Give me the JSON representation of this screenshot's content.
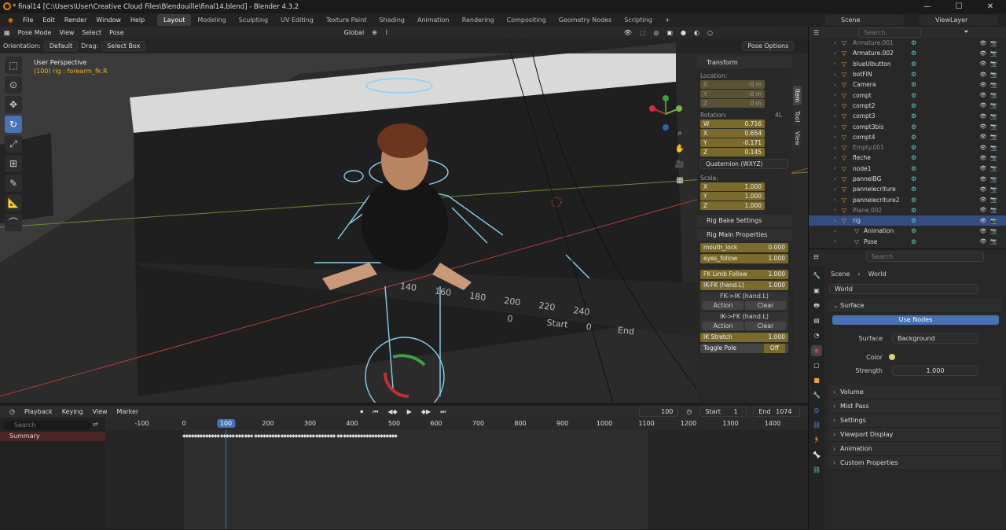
{
  "window": {
    "title": "* final14 [C:\\Users\\User\\Creative Cloud Files\\Blendouille\\final14.blend] - Blender 4.3.2"
  },
  "menu": {
    "items": [
      "File",
      "Edit",
      "Render",
      "Window",
      "Help"
    ],
    "workspaces": [
      "Layout",
      "Modeling",
      "Sculpting",
      "UV Editing",
      "Texture Paint",
      "Shading",
      "Animation",
      "Rendering",
      "Compositing",
      "Geometry Nodes",
      "Scripting"
    ],
    "add": "+",
    "scene": "Scene",
    "view_layer": "ViewLayer"
  },
  "viewport": {
    "mode": "Pose Mode",
    "menus": [
      "View",
      "Select",
      "Pose"
    ],
    "transform_orientation": "Global",
    "orientation_label": "Orientation:",
    "orientation_value": "Default",
    "drag_label": "Drag:",
    "drag_value": "Select Box",
    "pose_options": "Pose Options",
    "perspective": "User Perspective",
    "object_info": "(100) rig : forearm_fk.R",
    "bg_timeline": {
      "frames": [
        "0",
        "Start",
        "0",
        "End"
      ],
      "ticks": [
        "140",
        "160",
        "180",
        "200",
        "220",
        "240"
      ]
    }
  },
  "npanel": {
    "tabs": [
      "Item",
      "Tool",
      "View"
    ],
    "transform": {
      "title": "Transform",
      "location_label": "Location:",
      "location": [
        {
          "axis": "X",
          "value": "-0 m"
        },
        {
          "axis": "Y",
          "value": "-0 m"
        },
        {
          "axis": "Z",
          "value": "0 m"
        }
      ],
      "rotation_label": "Rotation:",
      "rotation_mode_short": "4L",
      "rotation": [
        {
          "axis": "W",
          "value": "0.716"
        },
        {
          "axis": "X",
          "value": "0.654"
        },
        {
          "axis": "Y",
          "value": "-0.171"
        },
        {
          "axis": "Z",
          "value": "0.145"
        }
      ],
      "rotation_mode": "Quaternion (WXYZ)",
      "scale_label": "Scale:",
      "scale": [
        {
          "axis": "X",
          "value": "1.000"
        },
        {
          "axis": "Y",
          "value": "1.000"
        },
        {
          "axis": "Z",
          "value": "1.000"
        }
      ]
    },
    "rig_bake": "Rig Bake Settings",
    "rig_main": "Rig Main Properties",
    "props": [
      {
        "name": "mouth_lock",
        "value": "0.000"
      },
      {
        "name": "eyes_follow",
        "value": "1.000"
      }
    ],
    "limb": [
      {
        "name": "FK Limb Follow",
        "value": "1.000"
      },
      {
        "name": "IK-FK (hand.L)",
        "value": "1.000"
      }
    ],
    "fk_ik": {
      "label": "FK->IK (hand.L)",
      "action": "Action",
      "clear": "Clear"
    },
    "ik_fk": {
      "label": "IK->FK (hand.L)",
      "action": "Action",
      "clear": "Clear"
    },
    "ik_stretch": {
      "name": "IK Stretch",
      "value": "1.000"
    },
    "toggle_pole": {
      "name": "Toggle Pole",
      "value": "Off"
    }
  },
  "timeline": {
    "menus": [
      "Playback",
      "Keying",
      "View",
      "Marker"
    ],
    "current_frame": "100",
    "start_label": "Start",
    "start": "1",
    "end_label": "End",
    "end": "1074",
    "search_placeholder": "Search",
    "summary": "Summary",
    "ticks": [
      "-100",
      "0",
      "100",
      "200",
      "300",
      "400",
      "500",
      "600",
      "700",
      "800",
      "900",
      "1000",
      "1100",
      "1200",
      "1300",
      "1400"
    ],
    "ruler_frame": "100"
  },
  "outliner": {
    "search_placeholder": "Search",
    "items": [
      {
        "name": "Armature.001",
        "dim": true
      },
      {
        "name": "Armature.002"
      },
      {
        "name": "blueUIbutton"
      },
      {
        "name": "botFIN"
      },
      {
        "name": "Camera"
      },
      {
        "name": "compt"
      },
      {
        "name": "compt2"
      },
      {
        "name": "compt3"
      },
      {
        "name": "compt3bis"
      },
      {
        "name": "compt4"
      },
      {
        "name": "Empty.001",
        "dim": true
      },
      {
        "name": "fleche"
      },
      {
        "name": "node1"
      },
      {
        "name": "pannelBG"
      },
      {
        "name": "pannelecriture"
      },
      {
        "name": "pannelecriture2"
      },
      {
        "name": "Plane.002",
        "dim": true
      },
      {
        "name": "rig",
        "sel": true
      },
      {
        "name": "Animation",
        "child": true
      },
      {
        "name": "Pose",
        "child": true
      }
    ]
  },
  "properties": {
    "search_placeholder": "Search",
    "breadcrumb": [
      "Scene",
      "World"
    ],
    "world_name": "World",
    "sections": {
      "surface": "Surface",
      "use_nodes": "Use Nodes",
      "surface_label": "Surface",
      "surface_value": "Background",
      "color_label": "Color",
      "strength_label": "Strength",
      "strength_value": "1.000"
    },
    "collapsed": [
      "Volume",
      "Mist Pass",
      "Settings",
      "Viewport Display",
      "Animation",
      "Custom Properties"
    ]
  }
}
